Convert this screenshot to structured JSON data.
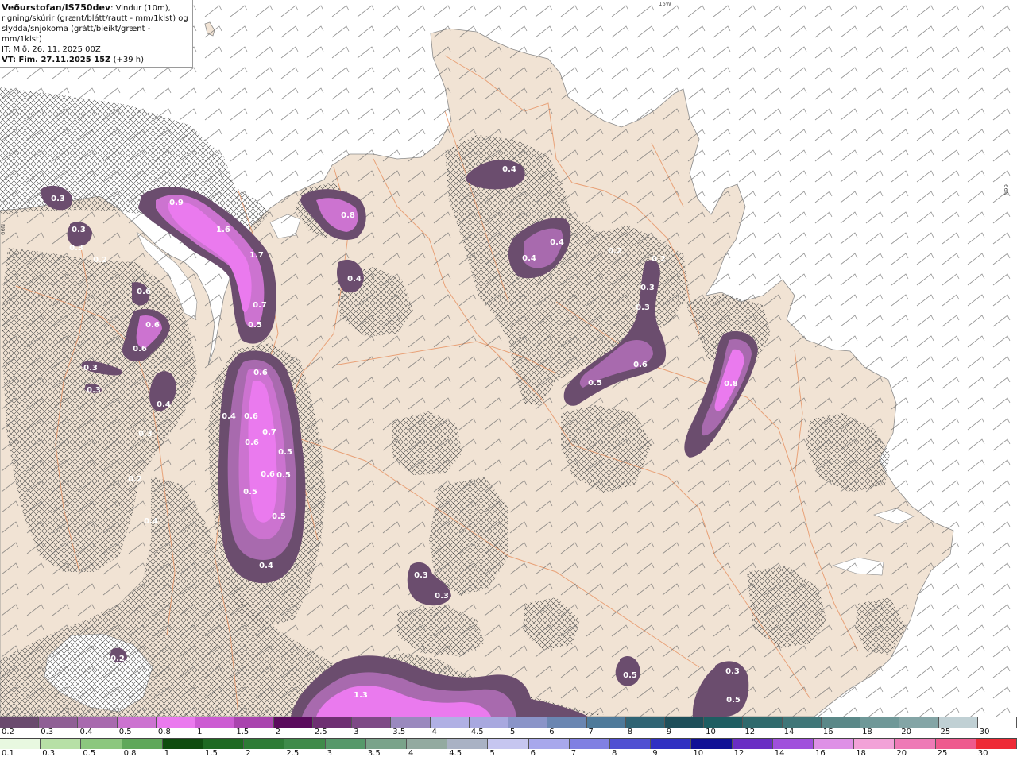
{
  "info": {
    "source": "Veðurstofan/IS750dev",
    "description_line1": ": Vindur (10m),",
    "description_line2": "rigning/skúrir (grænt/blátt/rautt - mm/1klst) og",
    "description_line3": "slydda/snjókoma (grátt/bleikt/grænt - mm/1klst)",
    "initial_time": "IT: Mið. 26. 11. 2025 00Z",
    "valid_label": "VT: Fim. 27.11.2025 15Z",
    "valid_offset": "(+39 h)"
  },
  "grid_labels": {
    "lon": "15W",
    "lat_left": "66N",
    "lat_right": "66N"
  },
  "precip_labels": [
    {
      "text": "0.3"
    },
    {
      "text": "0.3"
    },
    {
      "text": "0.3"
    },
    {
      "text": "0.2"
    },
    {
      "text": "0.9"
    },
    {
      "text": "1.6"
    },
    {
      "text": "1.7"
    },
    {
      "text": "0.7"
    },
    {
      "text": "0.5"
    },
    {
      "text": "0.8"
    },
    {
      "text": "0.4"
    },
    {
      "text": "0.4"
    },
    {
      "text": "0.4"
    },
    {
      "text": "0.4"
    },
    {
      "text": "0.2"
    },
    {
      "text": "0.2"
    },
    {
      "text": "0.3"
    },
    {
      "text": "0.3"
    },
    {
      "text": "0.6"
    },
    {
      "text": "0.5"
    },
    {
      "text": "0.8"
    },
    {
      "text": "0.6"
    },
    {
      "text": "0.6"
    },
    {
      "text": "0.6"
    },
    {
      "text": "0.3"
    },
    {
      "text": "0.3"
    },
    {
      "text": "0.4"
    },
    {
      "text": "0.3"
    },
    {
      "text": "0.6"
    },
    {
      "text": "0.4"
    },
    {
      "text": "0.6"
    },
    {
      "text": "0.7"
    },
    {
      "text": "0.6"
    },
    {
      "text": "0.5"
    },
    {
      "text": "0.6"
    },
    {
      "text": "0.5"
    },
    {
      "text": "0.5"
    },
    {
      "text": "0.5"
    },
    {
      "text": "0.4"
    },
    {
      "text": "0.3"
    },
    {
      "text": "0.3"
    },
    {
      "text": "0.2"
    },
    {
      "text": "1.3"
    },
    {
      "text": "0.5"
    },
    {
      "text": "0.3"
    },
    {
      "text": "0.5"
    },
    {
      "text": "0.2"
    },
    {
      "text": "0.4"
    }
  ],
  "legend_snow": {
    "labels": [
      "0.2",
      "0.3",
      "0.4",
      "0.5",
      "0.8",
      "1",
      "1.5",
      "2",
      "2.5",
      "3",
      "3.5",
      "4",
      "4.5",
      "5",
      "6",
      "7",
      "8",
      "9",
      "10",
      "12",
      "14",
      "16",
      "18",
      "20",
      "25",
      "30"
    ],
    "colors": [
      "#6a4a6e",
      "#8f5f95",
      "#a86aae",
      "#cc73d0",
      "#ea7aee",
      "#cc5cd2",
      "#a944ae",
      "#5a0a5c",
      "#6e2f72",
      "#7e4a86",
      "#9a89be",
      "#b0b0e4",
      "#a8a8df",
      "#8a94c8",
      "#6a86b2",
      "#4e7a9a",
      "#2f6474",
      "#1e4f5a",
      "#1e5e62",
      "#2f6a6c",
      "#3f7678",
      "#5a8888",
      "#6f9898",
      "#84a5a6",
      "#c0d0d4",
      "#ffffff"
    ]
  },
  "legend_rain": {
    "labels": [
      "0.1",
      "0.3",
      "0.5",
      "0.8",
      "1",
      "1.5",
      "2",
      "2.5",
      "3",
      "3.5",
      "4",
      "4.5",
      "5",
      "6",
      "7",
      "8",
      "9",
      "10",
      "12",
      "14",
      "16",
      "18",
      "20",
      "25",
      "30"
    ],
    "colors": [
      "#e8f8e0",
      "#b7e0a6",
      "#8cc77e",
      "#5fa85a",
      "#0f4d0f",
      "#1e6a22",
      "#2e7c36",
      "#3f8b4a",
      "#56996a",
      "#7aa38a",
      "#93aaa0",
      "#a9b2c4",
      "#c6c6f0",
      "#a8a8ec",
      "#8080e2",
      "#5050d2",
      "#3030c2",
      "#101095",
      "#6a2ec4",
      "#a050dc",
      "#de90e6",
      "#f2a2d8",
      "#ee7ab6",
      "#ee5a8e",
      "#ee2a36"
    ]
  }
}
